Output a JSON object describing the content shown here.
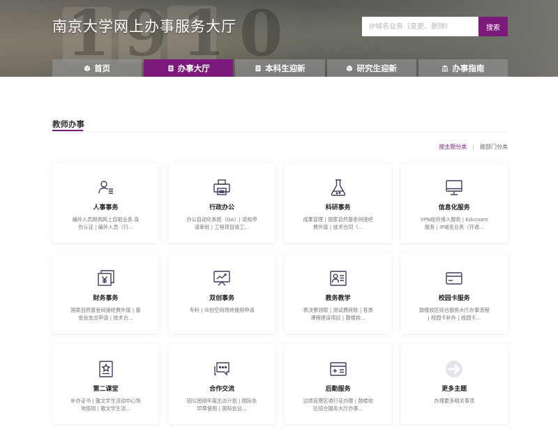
{
  "header": {
    "site_title": "南京大学网上办事服务大厅",
    "search_placeholder": "IP域名业务（变更、删除）",
    "search_button": "搜索"
  },
  "nav": {
    "tabs": [
      {
        "label": "首页",
        "icon": "cube-icon"
      },
      {
        "label": "办事大厅",
        "icon": "document-icon"
      },
      {
        "label": "本科生迎新",
        "icon": "document-icon"
      },
      {
        "label": "研究生迎新",
        "icon": "cube-icon"
      },
      {
        "label": "办事指南",
        "icon": "bank-icon"
      }
    ],
    "active_index": 1
  },
  "section": {
    "title": "教师办事",
    "sort_by_topic": "按主题分类",
    "separator": "|",
    "sort_by_dept": "按部门分类"
  },
  "cards": [
    {
      "name": "人事事务",
      "desc": "编外人员财务网上自助业务 身份认证 | 编外人员（行...",
      "icon": "personnel-icon"
    },
    {
      "name": "行政办公",
      "desc": "办公自动化系统（OA）| 返校申请审批 | 工程项目竣工...",
      "icon": "printer-icon"
    },
    {
      "name": "科研事务",
      "desc": "成果管理 | 国家自然基金间接经费外拨 | 技术合同（...",
      "icon": "flask-icon"
    },
    {
      "name": "信息化服务",
      "desc": "VPN校外接入服务 | Eduroam服务 | IP域名业务（开通...",
      "icon": "monitor-icon"
    },
    {
      "name": "财务事务",
      "desc": "国家自然基金间接经费外拨 | 基金会支出申请 | 技术合...",
      "icon": "finance-icon"
    },
    {
      "name": "双创事务",
      "desc": "专利 | 众创空间场地使用申请",
      "icon": "innovation-icon"
    },
    {
      "name": "教务教学",
      "desc": "表决票领取 | 测试费转账 | 各类课程建设项目 | 鼓楼校...",
      "icon": "teaching-icon"
    },
    {
      "name": "校园卡服务",
      "desc": "鼓楼校区综合服务大厅办事流程 | 校园卡补办 | 校园卡...",
      "icon": "card-icon"
    },
    {
      "name": "第二课堂",
      "desc": "补办证书 | 敬文学生活动中心场地借用 | 敬文学生活...",
      "icon": "certificate-icon"
    },
    {
      "name": "合作交流",
      "desc": "因公团组年度出访计划 | 国际处印章使用 | 国际会议...",
      "icon": "chat-icon"
    },
    {
      "name": "后勤服务",
      "desc": "边境管理区通行证办理 | 鼓楼校区综合服务大厅办事...",
      "icon": "logistics-icon"
    },
    {
      "name": "更多主题",
      "desc": "办理更多相关事项",
      "icon": "arrow-right-icon"
    }
  ],
  "colors": {
    "accent": "#7b1a7b",
    "icon_stroke": "#3b3b5c"
  }
}
